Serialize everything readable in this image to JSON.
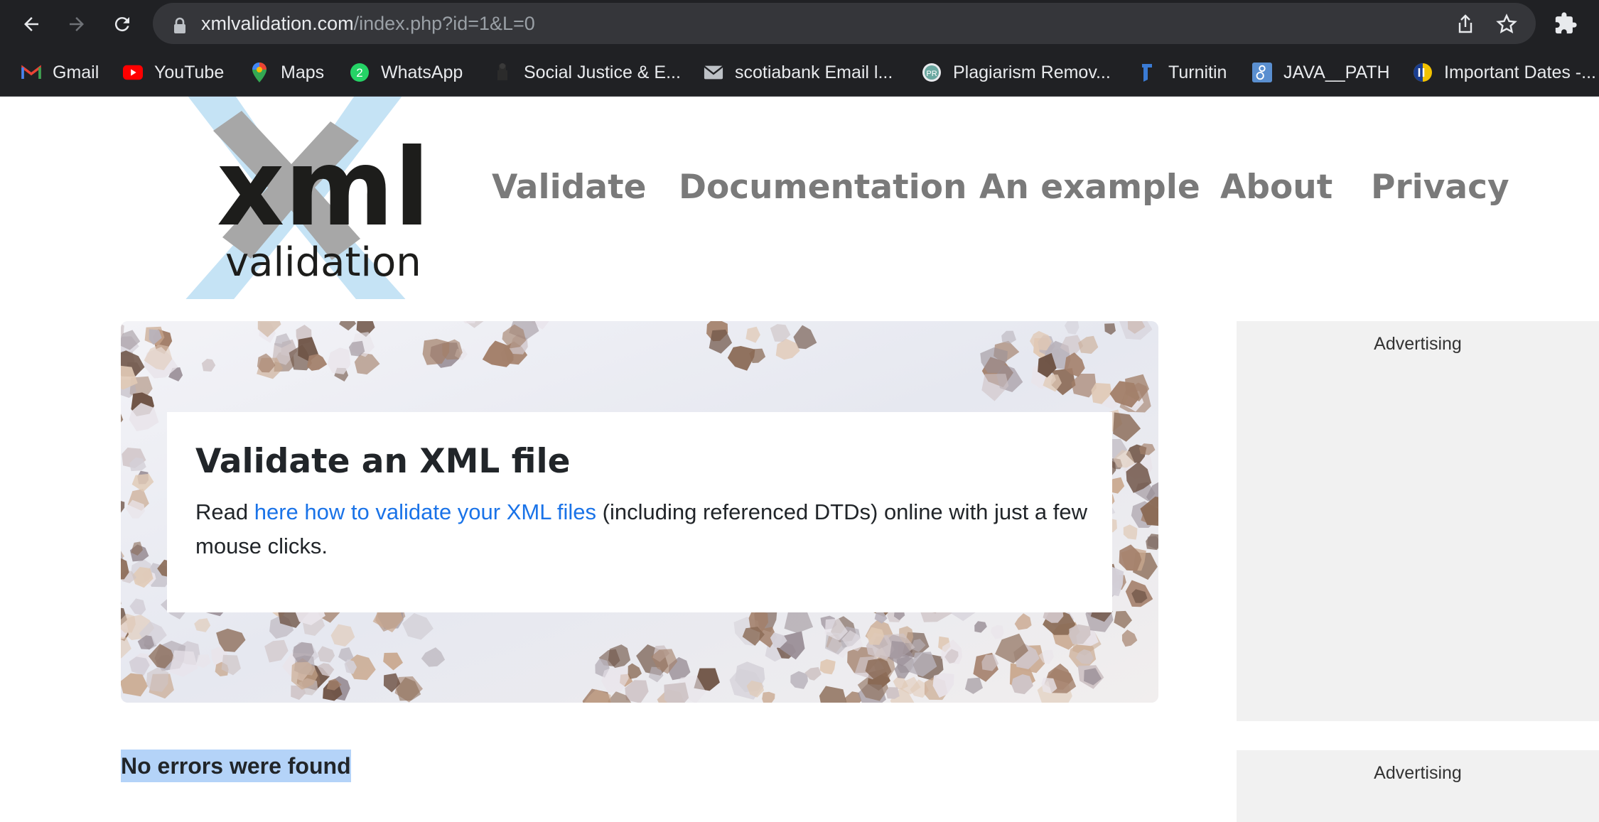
{
  "browser": {
    "url_host": "xmlvalidation.com",
    "url_path": "/index.php?id=1&L=0",
    "bookmarks": [
      {
        "label": "Gmail",
        "icon": "gmail-icon"
      },
      {
        "label": "YouTube",
        "icon": "youtube-icon"
      },
      {
        "label": "Maps",
        "icon": "maps-icon"
      },
      {
        "label": "WhatsApp",
        "icon": "whatsapp-icon"
      },
      {
        "label": "Social Justice & E...",
        "icon": "emblem-icon"
      },
      {
        "label": "scotiabank Email l...",
        "icon": "mail-icon"
      },
      {
        "label": "Plagiarism Remov...",
        "icon": "plagiarism-icon"
      },
      {
        "label": "Turnitin",
        "icon": "turnitin-icon"
      },
      {
        "label": "JAVA__PATH",
        "icon": "java-path-icon"
      },
      {
        "label": "Important Dates -...",
        "icon": "dates-icon"
      }
    ],
    "whatsapp_badge": "2"
  },
  "site": {
    "logo_xml": "xml",
    "logo_sub": "validation",
    "nav": [
      "Validate",
      "Documentation",
      "An example",
      "About",
      "Privacy"
    ]
  },
  "hero": {
    "title": "Validate an XML file",
    "text_before": "Read ",
    "link": "here how to validate your XML files",
    "text_after": " (including referenced DTDs) online with just a few mouse clicks."
  },
  "result": "No errors were found",
  "ads": [
    "Advertising",
    "Advertising"
  ],
  "colors": {
    "chrome": "#202124",
    "omnibox": "#35363a",
    "nav_text": "#7a7a7a",
    "link": "#1a73e8",
    "selection": "#b4d3f8",
    "logo_x": "#c5e3f5"
  }
}
